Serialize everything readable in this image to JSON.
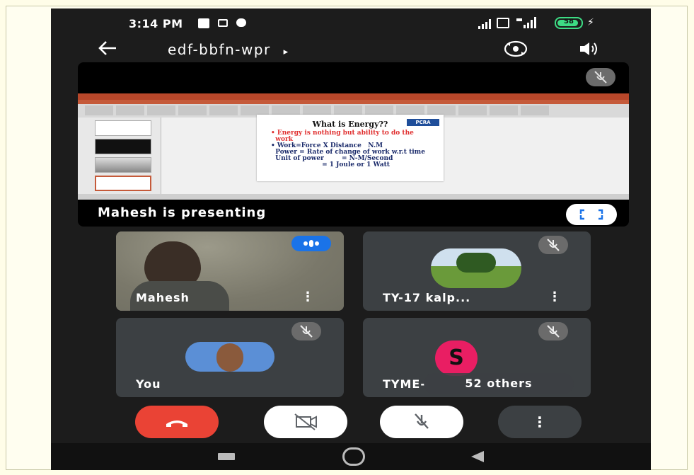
{
  "status_bar": {
    "time": "3:14 PM",
    "battery": "58"
  },
  "top_bar": {
    "meeting_code": "edf-bbfn-wpr",
    "title_chevron": "▸"
  },
  "presentation": {
    "presenter_label": "Mahesh is presenting",
    "slide": {
      "title": "What is Energy??",
      "logo": "PCRA",
      "lines": [
        {
          "text": "• Energy is nothing but ability to do the",
          "color": "#e03030"
        },
        {
          "text": "  work",
          "color": "#e03030"
        },
        {
          "text": "• Work=Force X Distance   N.M",
          "color": "#1a2a6a"
        },
        {
          "text": "  Power = Rate of change of work w.r.t time",
          "color": "#1a2a6a"
        },
        {
          "text": "  Unit of power        = N-M/Second",
          "color": "#1a2a6a"
        },
        {
          "text": "                       = 1 Joule or 1 Watt",
          "color": "#1a2a6a"
        }
      ]
    }
  },
  "participants": [
    {
      "name": "Mahesh",
      "speaking": true
    },
    {
      "name": "TY-17 kalp...",
      "muted": true
    },
    {
      "name": "You",
      "muted": true
    },
    {
      "name": "TYME-",
      "avatar_letter": "S",
      "others_label": "52 others",
      "muted": true
    }
  ],
  "colors": {
    "end_call": "#ea4335",
    "speaking": "#1a73e8",
    "avatar_s": "#e91e63"
  }
}
